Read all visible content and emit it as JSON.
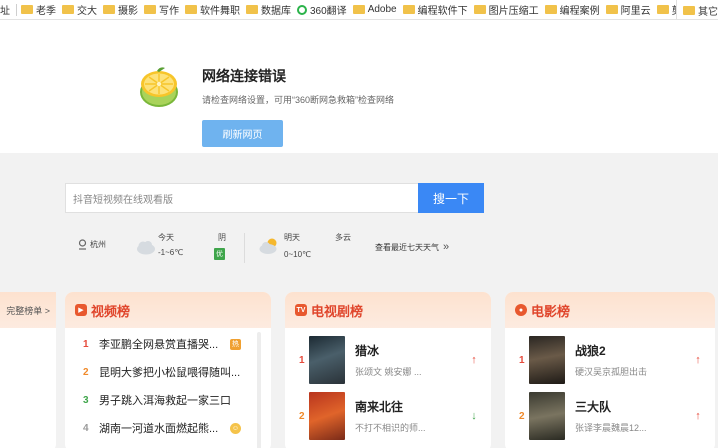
{
  "bookmarks": [
    {
      "label": "址",
      "icon": "none"
    },
    {
      "label": "老季",
      "icon": "folder-icon"
    },
    {
      "label": "交大",
      "icon": "folder-icon"
    },
    {
      "label": "摄影",
      "icon": "folder-icon"
    },
    {
      "label": "写作",
      "icon": "folder-icon"
    },
    {
      "label": "软件舞职",
      "icon": "folder-icon"
    },
    {
      "label": "数据库",
      "icon": "folder-icon"
    },
    {
      "label": "360翻译",
      "icon": "translate-icon"
    },
    {
      "label": "Adobe",
      "icon": "folder-icon"
    },
    {
      "label": "编程软件下",
      "icon": "folder-icon"
    },
    {
      "label": "图片压缩工",
      "icon": "folder-icon"
    },
    {
      "label": "编程案例",
      "icon": "folder-icon"
    },
    {
      "label": "阿里云",
      "icon": "folder-icon"
    },
    {
      "label": "剪映",
      "icon": "folder-icon"
    }
  ],
  "bookmarks_other": "其它",
  "error": {
    "title": "网络连接错误",
    "description": "请检查网络设置，可用“360断网急救箱”检查网络",
    "refresh_label": "刷新网页"
  },
  "search": {
    "placeholder": "抖音短视频在线观看版",
    "button_label": "搜一下"
  },
  "weather": {
    "city": "杭州",
    "today_label": "今天",
    "today_temp": "-1~6℃",
    "today_cond": "阴",
    "aqi": "优",
    "tomorrow_label": "明天",
    "tomorrow_temp": "0~10℃",
    "tomorrow_cond": "多云",
    "week_link": "查看最近七天天气"
  },
  "left_panel_link": "完整榜单 >",
  "video_rank": {
    "title": "视频榜",
    "items": [
      {
        "rank": "1",
        "text": "李亚鹏全网悬赏直播哭..."
      },
      {
        "rank": "2",
        "text": "昆明大爹把小松鼠喂得随叫..."
      },
      {
        "rank": "3",
        "text": "男子跳入洱海救起一家三口"
      },
      {
        "rank": "4",
        "text": "湖南一河道水面燃起熊..."
      }
    ]
  },
  "tv_rank": {
    "title": "电视剧榜",
    "items": [
      {
        "rank": "1",
        "title": "猎冰",
        "sub": "张颂文 姚安娜 ...",
        "trend": "up"
      },
      {
        "rank": "2",
        "title": "南来北往",
        "sub": "不打不相识的师...",
        "trend": "down"
      }
    ]
  },
  "movie_rank": {
    "title": "电影榜",
    "items": [
      {
        "rank": "1",
        "title": "战狼2",
        "sub": "硬汉吴京孤胆出击",
        "trend": "up"
      },
      {
        "rank": "2",
        "title": "三大队",
        "sub": "张译李晨魏晨12...",
        "trend": "up"
      }
    ]
  },
  "colors": {
    "accent_blue": "#3a88f5",
    "refresh_blue": "#6fb3ef",
    "rank_red": "#e64a3b",
    "rank_orange": "#f08a2a",
    "rank_green": "#3fa54b"
  }
}
